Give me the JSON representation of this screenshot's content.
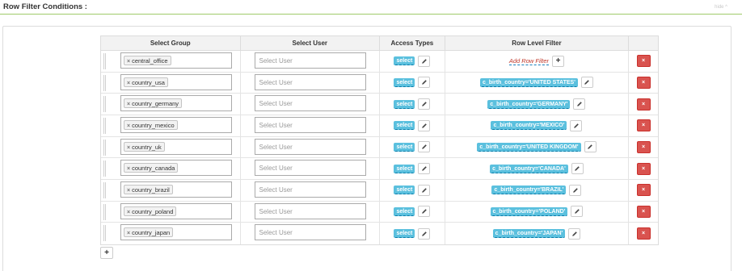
{
  "header": {
    "title": "Row Filter Conditions :",
    "hide_label": "hide ^"
  },
  "table": {
    "columns": [
      "Select Group",
      "Select User",
      "Access Types",
      "Row Level Filter",
      ""
    ],
    "user_placeholder": "Select User",
    "access_label": "select",
    "add_filter_label": "Add Row Filter",
    "rows": [
      {
        "group": "central_office",
        "filter": ""
      },
      {
        "group": "country_usa",
        "filter": "c_birth_country='UNITED STATES'"
      },
      {
        "group": "country_germany",
        "filter": "c_birth_country='GERMANY'"
      },
      {
        "group": "country_mexico",
        "filter": "c_birth_country='MEXICO'"
      },
      {
        "group": "country_uk",
        "filter": "c_birth_country='UNITED KINGDOM'"
      },
      {
        "group": "country_canada",
        "filter": "c_birth_country='CANADA'"
      },
      {
        "group": "country_brazil",
        "filter": "c_birth_country='BRAZIL'"
      },
      {
        "group": "country_poland",
        "filter": "c_birth_country='POLAND'"
      },
      {
        "group": "country_japan",
        "filter": "c_birth_country='JAPAN'"
      }
    ]
  },
  "icons": {
    "tag_remove": "×",
    "edit": "pencil-icon",
    "add": "+",
    "delete": "×"
  },
  "colors": {
    "accent_line": "#9fca6a",
    "label_bg": "#5bc0de",
    "danger": "#d9534f",
    "add_filter_text": "#c0392b"
  }
}
